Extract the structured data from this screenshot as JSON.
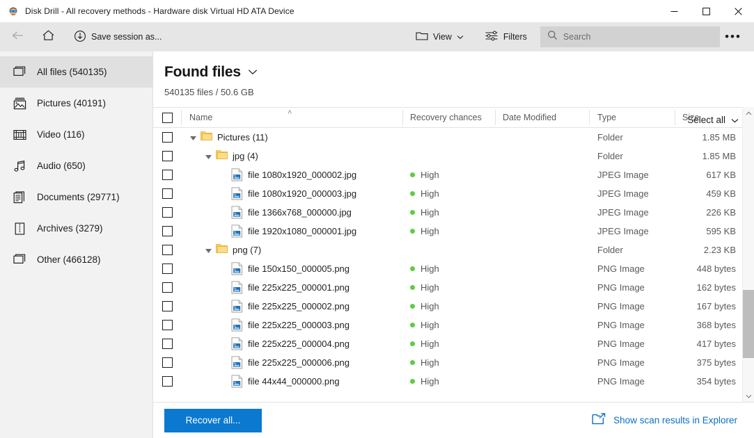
{
  "window": {
    "title": "Disk Drill - All recovery methods - Hardware disk Virtual HD ATA Device",
    "app_icon": "disk-drill-icon",
    "minimize": "—",
    "maximize": "□",
    "close": "✕"
  },
  "toolbar": {
    "back_label": "back-arrow-icon",
    "home_label": "home-icon",
    "save_session_label": "Save session as...",
    "view_label": "View",
    "filters_label": "Filters",
    "more_label": "•••",
    "search": {
      "value": "",
      "placeholder": "Search"
    }
  },
  "sidebar": {
    "items": [
      {
        "label": "All files (540135)",
        "icon": "all-files-icon",
        "active": true
      },
      {
        "label": "Pictures (40191)",
        "icon": "pictures-icon",
        "active": false
      },
      {
        "label": "Video (116)",
        "icon": "video-icon",
        "active": false
      },
      {
        "label": "Audio (650)",
        "icon": "audio-icon",
        "active": false
      },
      {
        "label": "Documents (29771)",
        "icon": "documents-icon",
        "active": false
      },
      {
        "label": "Archives (3279)",
        "icon": "archives-icon",
        "active": false
      },
      {
        "label": "Other (466128)",
        "icon": "other-icon",
        "active": false
      }
    ]
  },
  "main": {
    "title": "Found files",
    "title_chevron": "chevron-down-icon",
    "subtitle": "540135 files / 50.6 GB",
    "select_all_label": "Select all",
    "select_all_chevron": "chevron-down-icon"
  },
  "table": {
    "sort_indicator": "˄",
    "columns": [
      {
        "key": "check",
        "label": ""
      },
      {
        "key": "name",
        "label": "Name"
      },
      {
        "key": "recovery",
        "label": "Recovery chances"
      },
      {
        "key": "date",
        "label": "Date Modified"
      },
      {
        "key": "type",
        "label": "Type"
      },
      {
        "key": "size",
        "label": "Size"
      }
    ],
    "rows": [
      {
        "name": "Pictures (11)",
        "recovery": "",
        "date": "",
        "type": "Folder",
        "size": "1.85 MB",
        "kind": "folder",
        "depth": 0,
        "expanded": true,
        "checked": false
      },
      {
        "name": "jpg (4)",
        "recovery": "",
        "date": "",
        "type": "Folder",
        "size": "1.85 MB",
        "kind": "folder",
        "depth": 1,
        "expanded": true,
        "checked": false
      },
      {
        "name": "file 1080x1920_000002.jpg",
        "recovery": "High",
        "date": "",
        "type": "JPEG Image",
        "size": "617 KB",
        "kind": "image",
        "depth": 2,
        "expanded": null,
        "checked": false
      },
      {
        "name": "file 1080x1920_000003.jpg",
        "recovery": "High",
        "date": "",
        "type": "JPEG Image",
        "size": "459 KB",
        "kind": "image",
        "depth": 2,
        "expanded": null,
        "checked": false
      },
      {
        "name": "file 1366x768_000000.jpg",
        "recovery": "High",
        "date": "",
        "type": "JPEG Image",
        "size": "226 KB",
        "kind": "image",
        "depth": 2,
        "expanded": null,
        "checked": false
      },
      {
        "name": "file 1920x1080_000001.jpg",
        "recovery": "High",
        "date": "",
        "type": "JPEG Image",
        "size": "595 KB",
        "kind": "image",
        "depth": 2,
        "expanded": null,
        "checked": false
      },
      {
        "name": "png (7)",
        "recovery": "",
        "date": "",
        "type": "Folder",
        "size": "2.23 KB",
        "kind": "folder",
        "depth": 1,
        "expanded": true,
        "checked": false
      },
      {
        "name": "file 150x150_000005.png",
        "recovery": "High",
        "date": "",
        "type": "PNG Image",
        "size": "448 bytes",
        "kind": "image",
        "depth": 2,
        "expanded": null,
        "checked": false
      },
      {
        "name": "file 225x225_000001.png",
        "recovery": "High",
        "date": "",
        "type": "PNG Image",
        "size": "162 bytes",
        "kind": "image",
        "depth": 2,
        "expanded": null,
        "checked": false
      },
      {
        "name": "file 225x225_000002.png",
        "recovery": "High",
        "date": "",
        "type": "PNG Image",
        "size": "167 bytes",
        "kind": "image",
        "depth": 2,
        "expanded": null,
        "checked": false
      },
      {
        "name": "file 225x225_000003.png",
        "recovery": "High",
        "date": "",
        "type": "PNG Image",
        "size": "368 bytes",
        "kind": "image",
        "depth": 2,
        "expanded": null,
        "checked": false
      },
      {
        "name": "file 225x225_000004.png",
        "recovery": "High",
        "date": "",
        "type": "PNG Image",
        "size": "417 bytes",
        "kind": "image",
        "depth": 2,
        "expanded": null,
        "checked": false
      },
      {
        "name": "file 225x225_000006.png",
        "recovery": "High",
        "date": "",
        "type": "PNG Image",
        "size": "375 bytes",
        "kind": "image",
        "depth": 2,
        "expanded": null,
        "checked": false
      },
      {
        "name": "file 44x44_000000.png",
        "recovery": "High",
        "date": "",
        "type": "PNG Image",
        "size": "354 bytes",
        "kind": "image",
        "depth": 2,
        "expanded": null,
        "checked": false
      }
    ]
  },
  "footer": {
    "recover_label": "Recover all...",
    "explorer_label": "Show scan results in Explorer",
    "explorer_icon": "open-folder-external-icon"
  },
  "colors": {
    "accent_blue": "#0b79d0",
    "link_blue": "#0b6fc4",
    "high_green": "#5fcc42",
    "folder_yellow": "#f3c544",
    "toolbar_grey": "#e6e6e6",
    "sidebar_grey": "#f2f2f2",
    "selected_grey": "#e0e0e0"
  }
}
